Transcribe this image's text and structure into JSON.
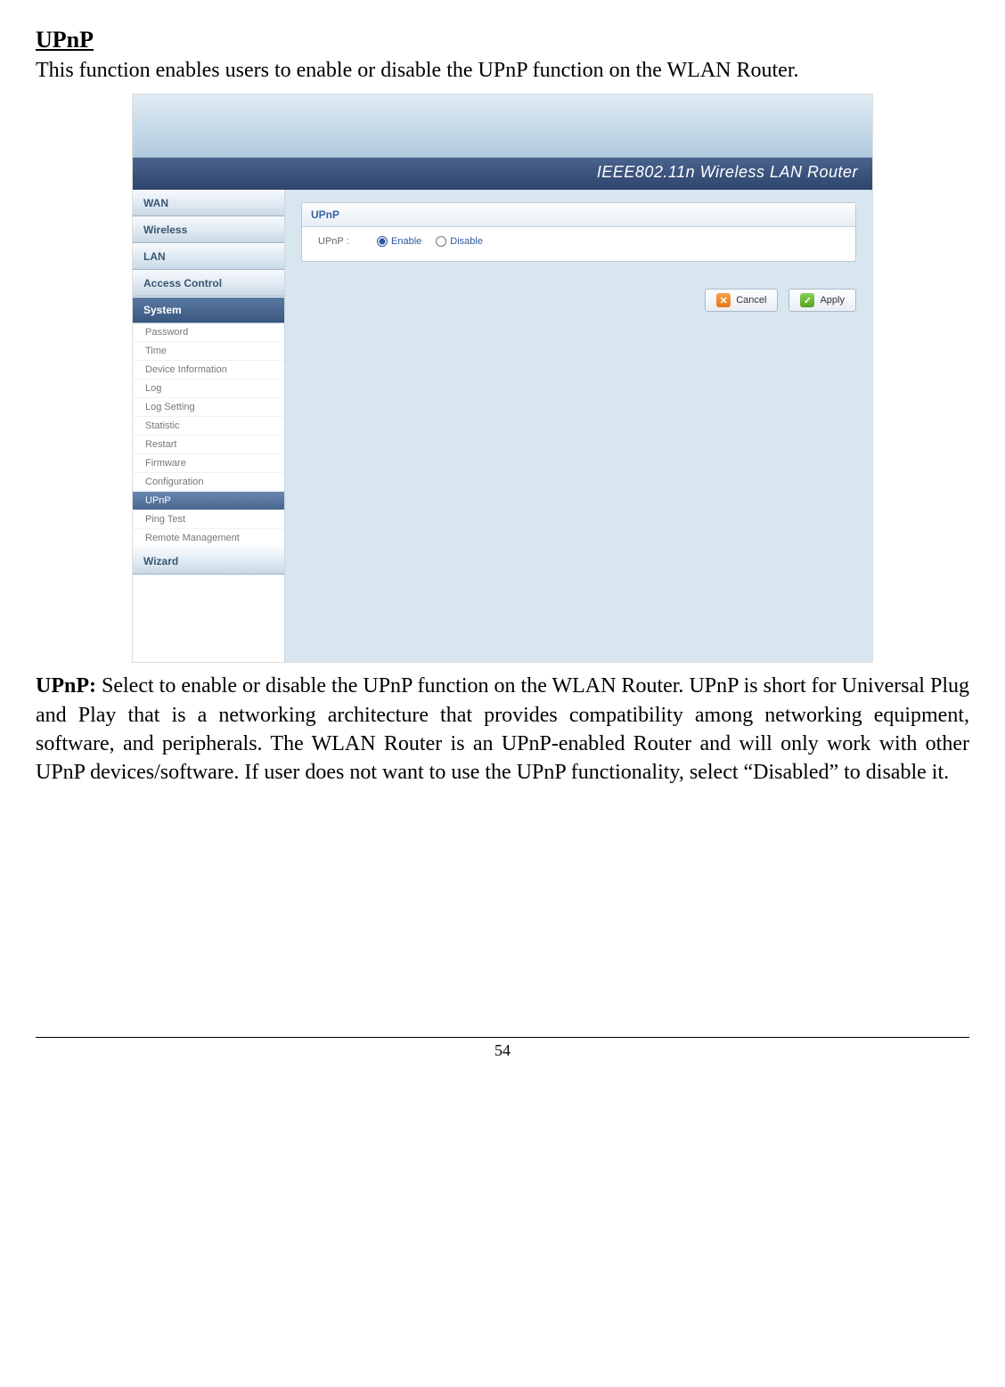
{
  "doc": {
    "section_title": "UPnP",
    "intro": "This function enables users to enable or disable the UPnP function on the WLAN Router.",
    "description_lead": "UPnP:",
    "description_body": " Select to enable or disable the UPnP function on the WLAN Router. UPnP is short for Universal Plug and Play that is a networking architecture that provides compatibility among networking equipment, software, and peripherals. The WLAN Router is an UPnP-enabled Router and will only work with other UPnP devices/software. If user does not want to use the UPnP functionality, select “Disabled” to disable it.",
    "page_number": "54"
  },
  "router": {
    "band_title": "IEEE802.11n  Wireless LAN Router",
    "sidebar": {
      "groups": [
        "WAN",
        "Wireless",
        "LAN",
        "Access Control",
        "System",
        "Wizard"
      ],
      "active_group_index": 4,
      "system_items": [
        "Password",
        "Time",
        "Device Information",
        "Log",
        "Log Setting",
        "Statistic",
        "Restart",
        "Firmware",
        "Configuration",
        "UPnP",
        "Ping Test",
        "Remote Management"
      ],
      "selected_item_index": 9
    },
    "panel": {
      "title": "UPnP",
      "field_label": "UPnP :",
      "options": {
        "enable": "Enable",
        "disable": "Disable"
      },
      "selected": "enable",
      "buttons": {
        "cancel": "Cancel",
        "apply": "Apply"
      }
    }
  }
}
